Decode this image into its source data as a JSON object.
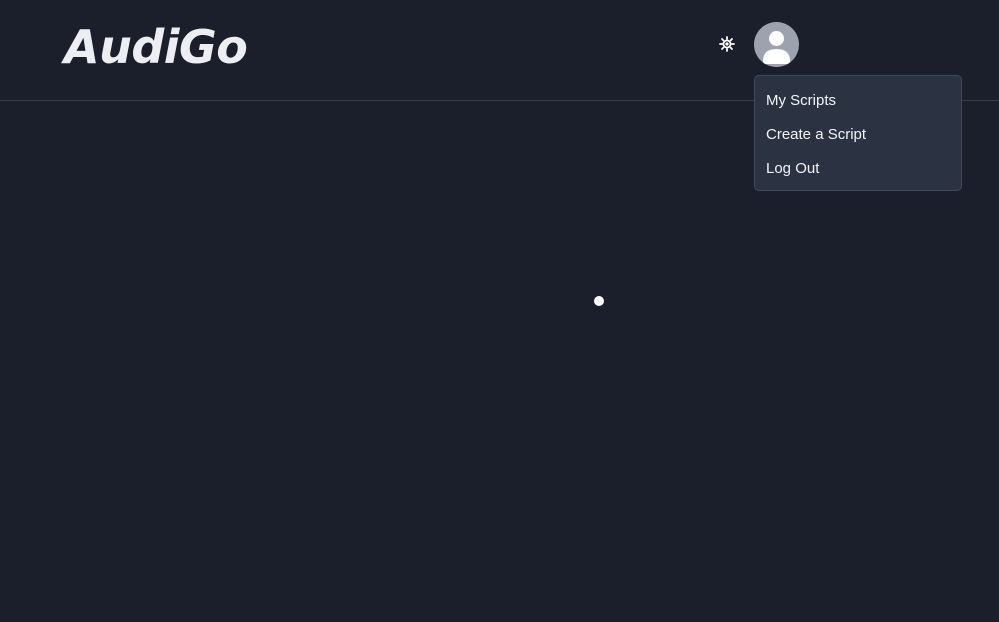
{
  "header": {
    "logo_text": "AudiGo",
    "theme_toggle_icon": "sun-icon",
    "avatar_icon": "user-avatar-icon"
  },
  "user_menu": {
    "items": [
      {
        "label": "My Scripts"
      },
      {
        "label": "Create a Script"
      },
      {
        "label": "Log Out"
      }
    ]
  },
  "main": {
    "loading_indicator": "loading-spinner"
  },
  "colors": {
    "background": "#1b1f2b",
    "menu_background": "#2b3242",
    "avatar_background": "#9ca3af"
  }
}
